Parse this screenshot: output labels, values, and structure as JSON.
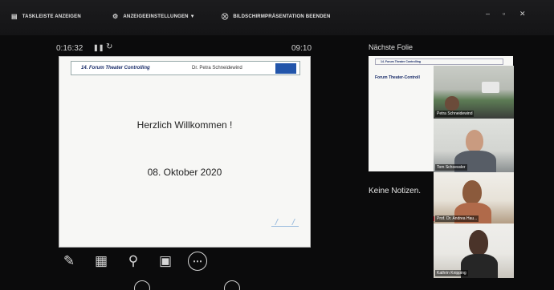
{
  "toolbar": {
    "taskbar": "TASKLEISTE ANZEIGEN",
    "display_settings": "ANZEIGEEINSTELLUNGEN ▼",
    "end_slideshow": "BILDSCHIRMPRÄSENTATION BEENDEN",
    "minimize": "–",
    "restore": "▫",
    "close": "✕"
  },
  "presenter": {
    "timer": "0:16:32",
    "clock": "09:10"
  },
  "slide": {
    "header_title": "14. Forum Theater Controlling",
    "header_author": "Dr. Petra Schneidewind",
    "welcome": "Herzlich Willkommen !",
    "date": "08. Oktober 2020"
  },
  "next_slide": {
    "label": "Nächste Folie",
    "thumb_title": "14. Forum Theater Controlling",
    "thumb_subtitle": "Forum Theater-Controll"
  },
  "notes": {
    "text": "Keine Notizen."
  },
  "participants": [
    {
      "name": "Petra Schneidewind"
    },
    {
      "name": "Tom Schoessler"
    },
    {
      "name": "Prof. Dr. Andrea Hau..."
    },
    {
      "name": "Kathrin Knipping"
    }
  ],
  "icons": {
    "pen": "pen-icon",
    "grid": "slide-grid-icon",
    "zoom": "zoom-icon",
    "screen": "screen-icon",
    "more": "more-options-icon"
  }
}
